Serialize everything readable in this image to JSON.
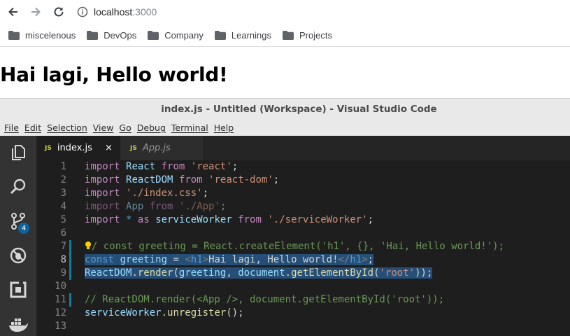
{
  "browser": {
    "url_host": "localhost",
    "url_port": ":3000",
    "bookmarks": [
      {
        "label": "miscelenous"
      },
      {
        "label": "DevOps"
      },
      {
        "label": "Company"
      },
      {
        "label": "Learnings"
      },
      {
        "label": "Projects"
      }
    ]
  },
  "page": {
    "heading": "Hai lagi, Hello world!"
  },
  "vscode": {
    "window_title": "index.js - Untitled (Workspace) - Visual Studio Code",
    "menu": [
      "File",
      "Edit",
      "Selection",
      "View",
      "Go",
      "Debug",
      "Terminal",
      "Help"
    ],
    "scm_badge": "4",
    "tabs": [
      {
        "badge": "JS",
        "label": "index.js",
        "close": "×"
      },
      {
        "badge": "JS",
        "label": "App.js"
      }
    ],
    "line_numbers": [
      "1",
      "2",
      "3",
      "4",
      "5",
      "6",
      "7",
      "8",
      "9",
      "10",
      "11",
      "12",
      "13"
    ],
    "code": {
      "l1": [
        "import",
        " ",
        "React",
        " ",
        "from",
        " ",
        "'react'",
        ";"
      ],
      "l2": [
        "import",
        " ",
        "ReactDOM",
        " ",
        "from",
        " ",
        "'react-dom'",
        ";"
      ],
      "l3": [
        "import",
        " ",
        "'./index.css'",
        ";"
      ],
      "l4": [
        "import",
        " ",
        "App",
        " ",
        "from",
        " ",
        "'./App'",
        ";"
      ],
      "l5": [
        "import",
        " ",
        "*",
        " ",
        "as",
        " ",
        "serviceWorker",
        " ",
        "from",
        " ",
        "'./serviceWorker'",
        ";"
      ],
      "l7": "/ const greeting = React.createElement('h1', {}, 'Hai, Hello world!');",
      "l8": [
        "const",
        " ",
        "greeting",
        " = ",
        "<",
        "h1",
        ">",
        "Hai lagi, Hello world!",
        "</",
        "h1",
        ">",
        ";"
      ],
      "l9": [
        "ReactDOM",
        ".",
        "render",
        "(",
        "greeting",
        ", ",
        "document",
        ".",
        "getElementById",
        "(",
        "'root'",
        "));"
      ],
      "l11": "// ReactDOM.render(<App />, document.getElementById('root'));",
      "l12": [
        "serviceWorker",
        ".",
        "unregister",
        "();"
      ]
    }
  },
  "colors": {
    "editor_bg": "#1e1e1e",
    "activity_bg": "#333333",
    "selection": "#264f78",
    "keyword": "#c586c0",
    "string": "#ce9178",
    "variable": "#9cdcfe",
    "function": "#dcdcaa",
    "comment": "#6a9955",
    "js_badge": "#cbcb41",
    "scm_badge": "#0e639c"
  },
  "icons": [
    "back-arrow-icon",
    "forward-arrow-icon",
    "reload-icon",
    "info-icon",
    "folder-icon",
    "explorer-icon",
    "search-icon",
    "source-control-icon",
    "debug-icon",
    "extensions-icon",
    "docker-icon",
    "lightbulb-icon",
    "close-icon"
  ]
}
